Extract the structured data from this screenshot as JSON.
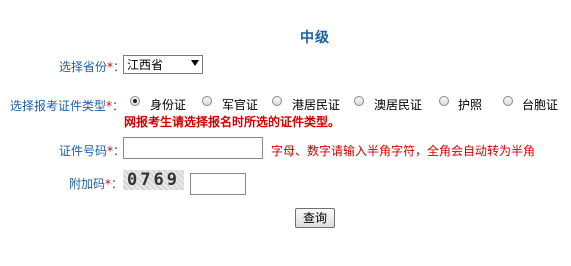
{
  "title": "中级",
  "province": {
    "label": "选择省份",
    "selected": "江西省"
  },
  "cert_type": {
    "label": "选择报考证件类型",
    "options": [
      "身份证",
      "军官证",
      "港居民证",
      "澳居民证",
      "护照",
      "台胞证"
    ],
    "selected_index": 0,
    "note": "网报考生请选择报名时所选的证件类型。"
  },
  "cert_number": {
    "label": "证件号码",
    "value": "",
    "hint": "字母、数字请输入半角字符，全角会自动转为半角"
  },
  "captcha": {
    "label": "附加码",
    "image_text": "0769",
    "value": ""
  },
  "required_mark": "*",
  "label_suffix": "：",
  "submit_label": "查询"
}
